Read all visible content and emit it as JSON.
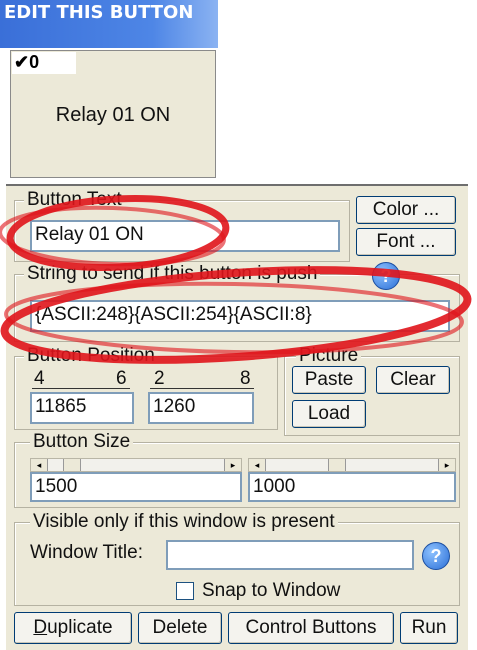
{
  "window": {
    "title": "EDIT THIS BUTTON"
  },
  "preview": {
    "check_label": "0",
    "check_mark": "✔",
    "button_label": "Relay 01 ON"
  },
  "button_text": {
    "legend": "Button Text",
    "value": "Relay 01 ON",
    "color_label": "Color ...",
    "font_label": "Font ..."
  },
  "string_to_send": {
    "legend": "String to send if this button is push",
    "value": "{ASCII:248}{ASCII:254}{ASCII:8}",
    "help": "?"
  },
  "position": {
    "legend": "Button Position",
    "ticks_x": [
      "4",
      "6"
    ],
    "ticks_y": [
      "2",
      "8"
    ],
    "x_value": "11865",
    "y_value": "1260"
  },
  "picture": {
    "legend": "Picture",
    "paste_label": "Paste",
    "clear_label": "Clear",
    "load_label": "Load"
  },
  "size": {
    "legend": "Button Size",
    "width_value": "1500",
    "height_value": "1000",
    "width_pos": 0.1,
    "height_pos": 0.4
  },
  "visibility": {
    "legend": "Visible only if this window is present",
    "window_title_label": "Window Title:",
    "window_title_value": "",
    "help": "?",
    "snap_label": "Snap to Window",
    "snap_checked": false
  },
  "actions": {
    "duplicate_label": "Duplicate",
    "delete_label": "Delete",
    "control_label": "Control Buttons",
    "run_label": "Run"
  },
  "colors": {
    "annotation": "#e0141b",
    "title_bar": "#4e86e6",
    "panel": "#ece9d8"
  }
}
